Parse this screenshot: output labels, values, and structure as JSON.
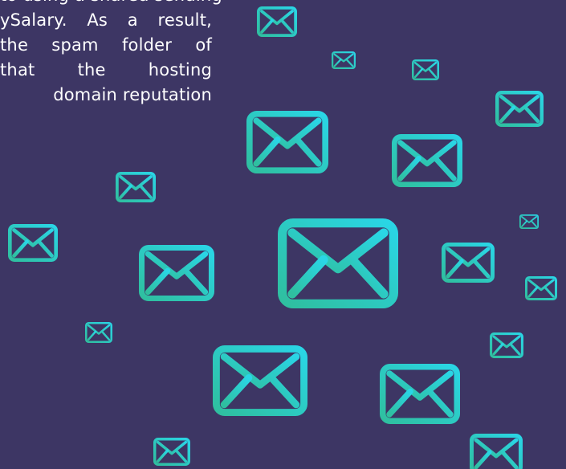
{
  "text": {
    "lines": [
      "to using a shared sending",
      "ySalary. As a result,",
      "the spam folder of",
      "that the hosting",
      "domain reputation"
    ]
  },
  "icons": {
    "envelope": "envelope-icon",
    "gradient_start": "#2fbf9f",
    "gradient_end": "#2ad6e6"
  },
  "colors": {
    "background": "#3d3664",
    "text": "#ffffff"
  }
}
